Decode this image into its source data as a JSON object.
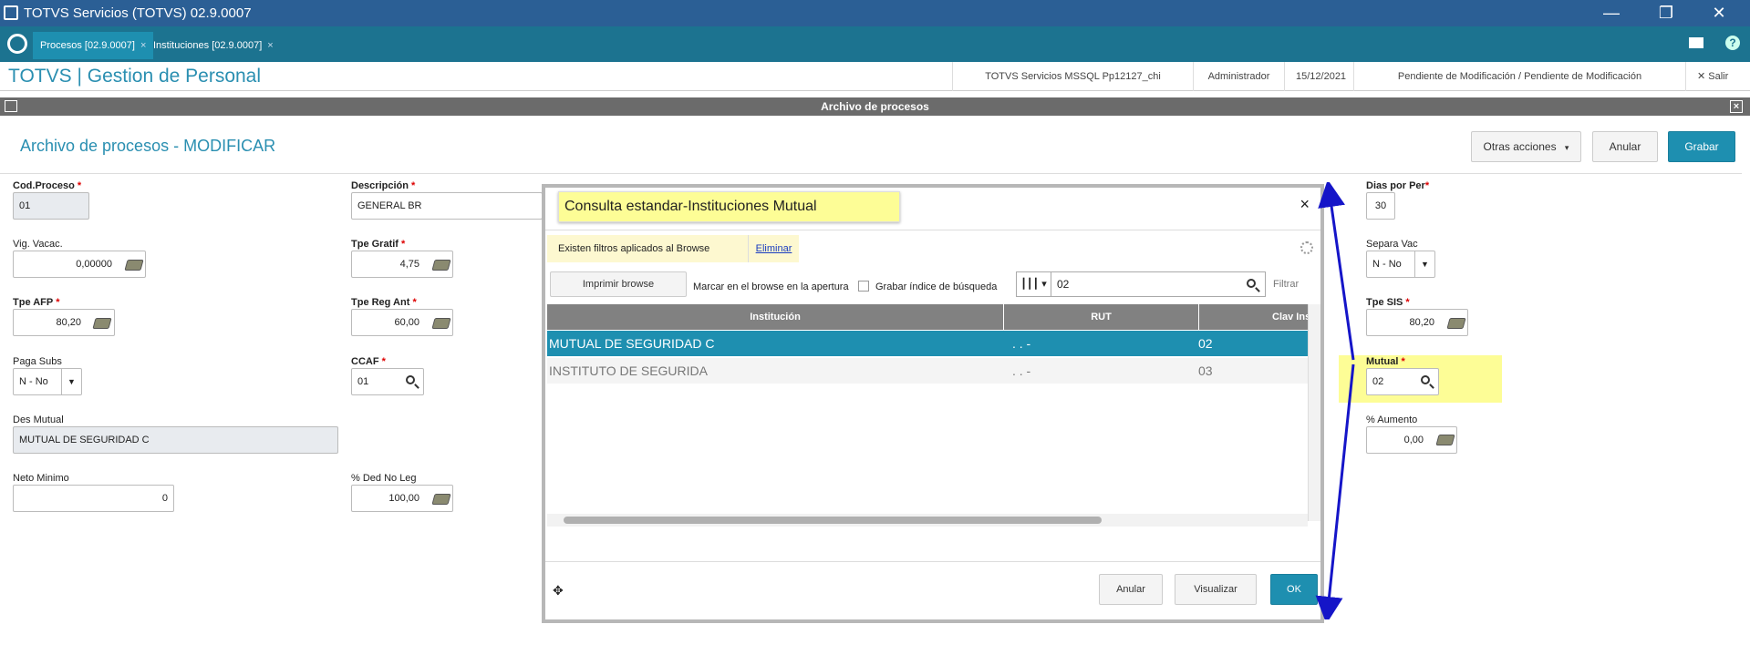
{
  "window": {
    "title": "TOTVS Servicios (TOTVS) 02.9.0007",
    "min": "—",
    "restore": "❐",
    "close": "✕"
  },
  "tabs": [
    {
      "label": "Procesos [02.9.0007]",
      "close": "×"
    },
    {
      "label": "Instituciones [02.9.0007]",
      "close": "×"
    }
  ],
  "header": {
    "brand": "TOTVS | Gestion de Personal",
    "server": "TOTVS Servicios MSSQL Pp12127_chi",
    "user": "Administrador",
    "date": "15/12/2021",
    "status": "Pendiente de Modificación / Pendiente de Modificación",
    "exit": "✕  Salir"
  },
  "dialog": {
    "title": "Archivo de procesos",
    "close": "×"
  },
  "page": {
    "title": "Archivo de procesos - MODIFICAR",
    "other_actions": "Otras acciones",
    "cancel": "Anular",
    "save": "Grabar"
  },
  "form": {
    "cod_proceso": {
      "label": "Cod.Proceso",
      "value": "01"
    },
    "descripcion": {
      "label": "Descripción",
      "value": "GENERAL BR"
    },
    "vig_vacac": {
      "label": "Vig. Vacac.",
      "value": "0,00000"
    },
    "tpe_gratif": {
      "label": "Tpe Gratif",
      "value": "4,75"
    },
    "tpe_afp": {
      "label": "Tpe AFP",
      "value": "80,20"
    },
    "tpe_reg_ant": {
      "label": "Tpe Reg Ant",
      "value": "60,00"
    },
    "paga_subs": {
      "label": "Paga Subs",
      "value": "N - No"
    },
    "ccaf": {
      "label": "CCAF",
      "value": "01"
    },
    "des_mutual": {
      "label": "Des Mutual",
      "value": "MUTUAL DE SEGURIDAD C"
    },
    "neto_minimo": {
      "label": "Neto Minimo",
      "value": "0"
    },
    "ded_no_leg": {
      "label": "% Ded No Leg",
      "value": "100,00"
    },
    "dias_por_per": {
      "label": "Dias por Per",
      "value": "30"
    },
    "separa_vac": {
      "label": "Separa Vac",
      "value": "N - No"
    },
    "tpe_sis": {
      "label": "Tpe SIS",
      "value": "80,20"
    },
    "mutual": {
      "label": "Mutual",
      "value": "02"
    },
    "aumento": {
      "label": "% Aumento",
      "value": "0,00"
    },
    "required_mark": "*"
  },
  "modal": {
    "title": "Consulta estandar-Instituciones Mutual",
    "close": "×",
    "filter_notice": "Existen filtros aplicados al Browse",
    "filter_remove": "Eliminar",
    "print_browse": "Imprimir browse",
    "mark_open": "Marcar en el browse en la apertura",
    "save_index": "Grabar índice de búsqueda",
    "search_value": "02",
    "filter": "Filtrar",
    "columns": [
      "Institución",
      "RUT",
      "Clav Ins"
    ],
    "rows": [
      [
        "MUTUAL DE SEGURIDAD C",
        ". . -",
        "02"
      ],
      [
        "INSTITUTO DE SEGURIDA",
        ". . -",
        "03"
      ]
    ],
    "cancel": "Anular",
    "view": "Visualizar",
    "ok": "OK"
  },
  "colors": {
    "accent": "#1e8fb0",
    "titlebar": "#2b5f95",
    "highlight": "#fdfd96",
    "arrow": "#1515c8"
  }
}
